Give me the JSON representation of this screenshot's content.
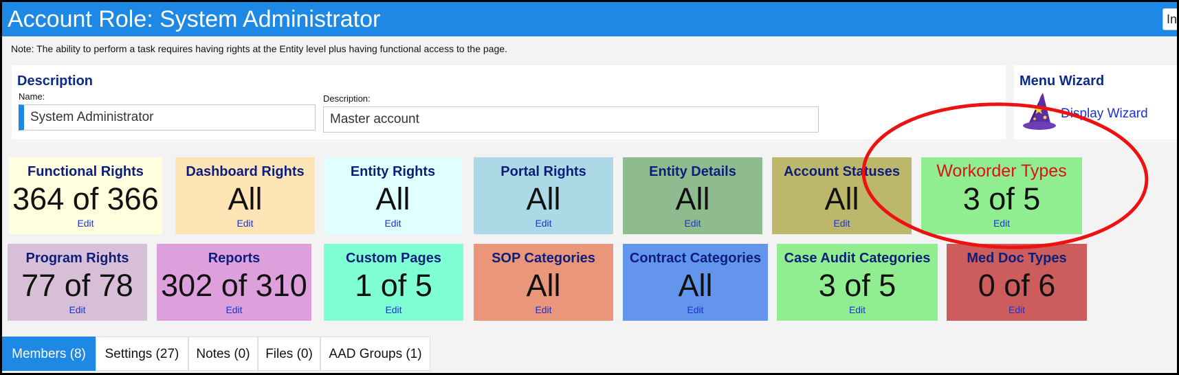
{
  "header": {
    "title": "Account Role: System Administrator",
    "right_button_label": "In"
  },
  "note": "Note: The ability to perform a task requires having rights at the Entity level plus having functional access to the page.",
  "description_panel": {
    "title": "Description",
    "name_label": "Name:",
    "name_value": "System Administrator",
    "description_label": "Description:",
    "description_value": "Master account"
  },
  "wizard_panel": {
    "title": "Menu Wizard",
    "link_label": "Display Wizard",
    "icon": "wizard-hat-icon"
  },
  "tiles": [
    {
      "id": "functional-rights",
      "title": "Functional Rights",
      "value": "364 of 366",
      "edit": "Edit",
      "color": "#ffffde"
    },
    {
      "id": "dashboard-rights",
      "title": "Dashboard Rights",
      "value": "All",
      "edit": "Edit",
      "color": "#ffe4b5"
    },
    {
      "id": "entity-rights",
      "title": "Entity Rights",
      "value": "All",
      "edit": "Edit",
      "color": "#e0ffff"
    },
    {
      "id": "portal-rights",
      "title": "Portal Rights",
      "value": "All",
      "edit": "Edit",
      "color": "#add8e6"
    },
    {
      "id": "entity-details",
      "title": "Entity Details",
      "value": "All",
      "edit": "Edit",
      "color": "#8fbc8f"
    },
    {
      "id": "account-statuses",
      "title": "Account Statuses",
      "value": "All",
      "edit": "Edit",
      "color": "#bdb76b"
    },
    {
      "id": "workorder-types",
      "title": "Workorder Types",
      "value": "3 of 5",
      "edit": "Edit",
      "color": "#90ee90",
      "title_color": "#e01010"
    },
    {
      "id": "program-rights",
      "title": "Program Rights",
      "value": "77 of 78",
      "edit": "Edit",
      "color": "#d8bfd8"
    },
    {
      "id": "reports",
      "title": "Reports",
      "value": "302 of 310",
      "edit": "Edit",
      "color": "#dda0dd"
    },
    {
      "id": "custom-pages",
      "title": "Custom Pages",
      "value": "1 of 5",
      "edit": "Edit",
      "color": "#7fffd4"
    },
    {
      "id": "sop-categories",
      "title": "SOP Categories",
      "value": "All",
      "edit": "Edit",
      "color": "#e9967a"
    },
    {
      "id": "contract-categories",
      "title": "Contract Categories",
      "value": "All",
      "edit": "Edit",
      "color": "#6495ed"
    },
    {
      "id": "case-audit-categories",
      "title": "Case Audit Categories",
      "value": "3 of 5",
      "edit": "Edit",
      "color": "#90ee90"
    },
    {
      "id": "med-doc-types",
      "title": "Med Doc Types",
      "value": "0 of 6",
      "edit": "Edit",
      "color": "#cd5c5c"
    }
  ],
  "tabs": [
    {
      "id": "members",
      "label": "Members (8)",
      "active": true
    },
    {
      "id": "settings",
      "label": "Settings (27)",
      "active": false
    },
    {
      "id": "notes",
      "label": "Notes (0)",
      "active": false
    },
    {
      "id": "files",
      "label": "Files (0)",
      "active": false
    },
    {
      "id": "aad-groups",
      "label": "AAD Groups (1)",
      "active": false
    }
  ],
  "annotation": {
    "shape": "ellipse",
    "color": "#ee1111",
    "highlights": "workorder-types"
  },
  "colors": {
    "header_bg": "#1e88e5",
    "panel_title": "#0b2a8a",
    "link": "#1a33cc",
    "tile_title": "#0c1d7a"
  }
}
